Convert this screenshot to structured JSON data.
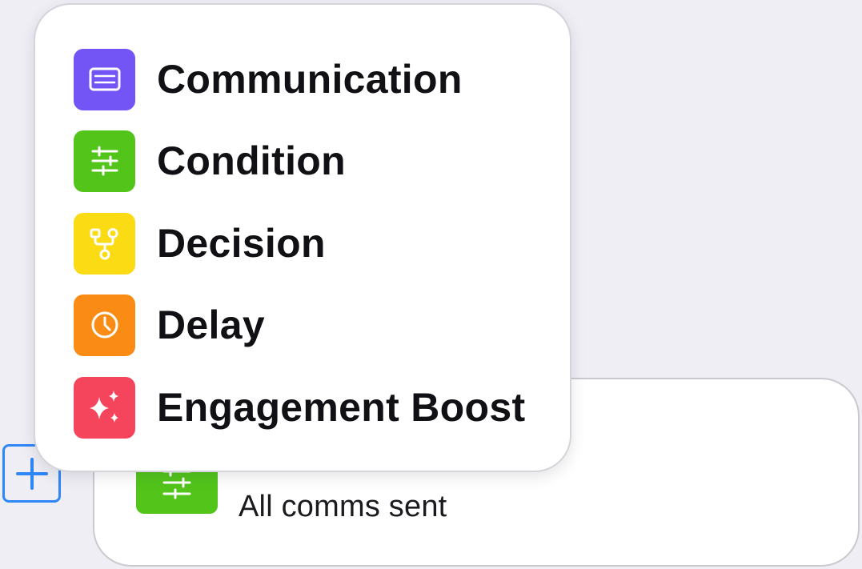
{
  "menu": {
    "items": [
      {
        "label": "Communication",
        "icon": "message-icon",
        "color": "#7354f5"
      },
      {
        "label": "Condition",
        "icon": "sliders-icon",
        "color": "#52c41a"
      },
      {
        "label": "Decision",
        "icon": "branch-icon",
        "color": "#fadb14"
      },
      {
        "label": "Delay",
        "icon": "clock-icon",
        "color": "#fa8c16"
      },
      {
        "label": "Engagement Boost",
        "icon": "sparkle-icon",
        "color": "#f5455c"
      }
    ]
  },
  "node": {
    "icon": "sliders-icon",
    "color": "#52c41a",
    "subtitle": "All comms sent"
  },
  "add_button": {
    "icon": "plus-icon",
    "color": "#2f86f6"
  }
}
